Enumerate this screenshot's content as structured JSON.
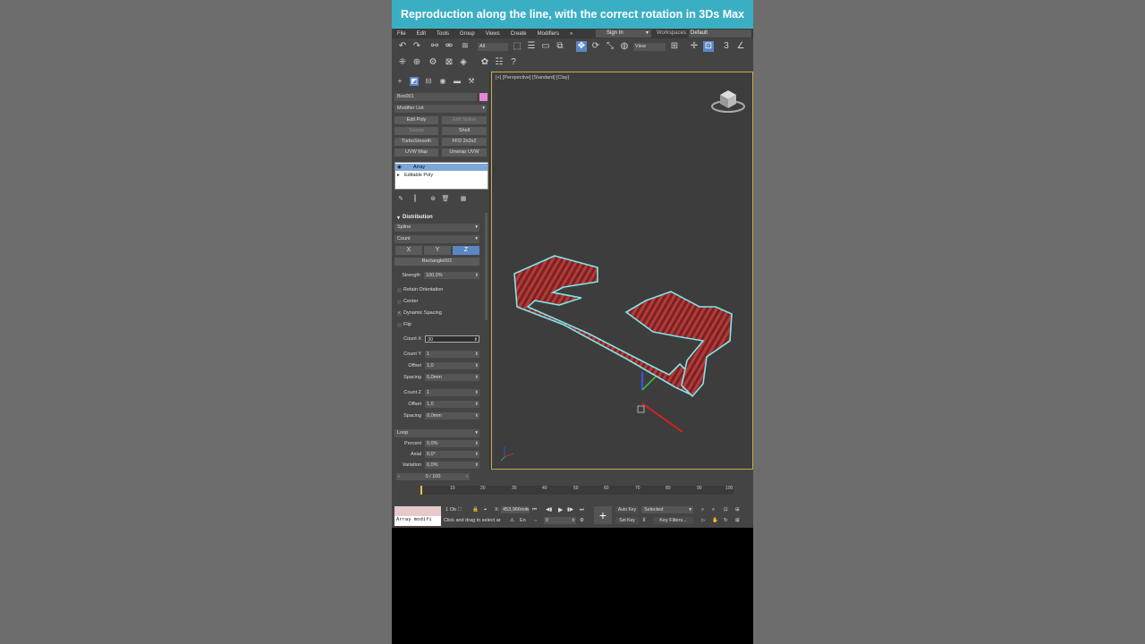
{
  "banner": {
    "title": "Reproduction along the line, with the correct rotation in 3Ds Max"
  },
  "menubar": {
    "items": [
      "File",
      "Edit",
      "Tools",
      "Group",
      "Views",
      "Create",
      "Modifiers",
      "»"
    ],
    "signin": "Sign In",
    "workspaces_label": "Workspaces:",
    "workspaces_value": "Default"
  },
  "toolbar": {
    "selection_filter": "All",
    "ref_coord": "View"
  },
  "command_panel": {
    "object_name": "Box001",
    "object_color": "#e487d8",
    "modifier_list": "Modifier List",
    "quick_buttons": [
      {
        "label": "Edit Poly",
        "dim": false
      },
      {
        "label": "Edit Spline",
        "dim": true
      },
      {
        "label": "Sweep",
        "dim": true
      },
      {
        "label": "Shell",
        "dim": false
      },
      {
        "label": "TurboSmooth",
        "dim": false
      },
      {
        "label": "FFD 2x2x2",
        "dim": false
      },
      {
        "label": "UVW Map",
        "dim": false
      },
      {
        "label": "Unwrap UVW",
        "dim": false
      }
    ],
    "stack": [
      "Array",
      "Editable Poly"
    ]
  },
  "distribution": {
    "title": "Distribution",
    "mode": "Spline",
    "type": "Count",
    "axes": [
      "X",
      "Y",
      "Z"
    ],
    "active_axis": "Z",
    "spline_pick": "Rectangle001",
    "strength_label": "Strength",
    "strength_value": "100,0%",
    "checkboxes": [
      {
        "label": "Retain Orientation",
        "checked": false
      },
      {
        "label": "Center",
        "checked": false
      },
      {
        "label": "Dynamic Spacing",
        "checked": true
      },
      {
        "label": "Flip",
        "checked": false
      }
    ],
    "count_x_label": "Count X",
    "count_x_value": "30",
    "count_y_label": "Count Y",
    "count_y_value": "1",
    "offset_y_label": "Offset",
    "offset_y_value": "1,0",
    "spacing_y_label": "Spacing",
    "spacing_y_value": "0,0mm",
    "count_z_label": "Count Z",
    "count_z_value": "1",
    "offset_z_label": "Offset",
    "offset_z_value": "1,0",
    "spacing_z_label": "Spacing",
    "spacing_z_value": "0,0mm",
    "loop_label": "Loop",
    "percent_label": "Percent",
    "percent_value": "0,0%",
    "axial_label": "Axial",
    "axial_value": "0,0°",
    "variation_label": "Variation",
    "variation_value": "0,0%"
  },
  "viewport": {
    "label": "[+] [Perspective] [Standard] [Clay]"
  },
  "timeline": {
    "frame": "0 / 100",
    "ticks": [
      "10",
      "20",
      "30",
      "40",
      "50",
      "60",
      "70",
      "80",
      "90",
      "100"
    ]
  },
  "status": {
    "script_text": "Array modifi",
    "selected_count": "1 Ob",
    "prompt": "Click and drag to select ar",
    "x_label": "X:",
    "x_value": "453,966mm",
    "en_label": "En",
    "frame_value": "0",
    "auto_key": "Auto Key",
    "set_key": "Set Key",
    "selected_dd": "Selected",
    "key_filters": "Key Filters..."
  }
}
